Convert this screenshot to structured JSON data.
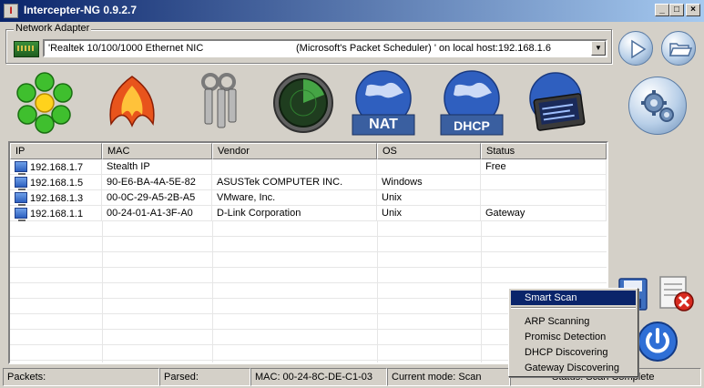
{
  "window": {
    "title": "Intercepter-NG 0.9.2.7",
    "minimize": "_",
    "maximize": "□",
    "close": "×"
  },
  "adapter": {
    "group_label": "Network Adapter",
    "name": "'Realtek 10/100/1000 Ethernet NIC",
    "host_text": "(Microsoft's Packet Scheduler) ' on local host:192.168.1.6"
  },
  "toolbar": {
    "nat_label": "NAT",
    "dhcp_label": "DHCP"
  },
  "table": {
    "columns": [
      "IP",
      "MAC",
      "Vendor",
      "OS",
      "Status"
    ],
    "rows": [
      {
        "ip": "192.168.1.7",
        "mac": "Stealth IP",
        "vendor": "",
        "os": "",
        "status": "Free"
      },
      {
        "ip": "192.168.1.5",
        "mac": "90-E6-BA-4A-5E-82",
        "vendor": "ASUSTek COMPUTER INC.",
        "os": "Windows",
        "status": ""
      },
      {
        "ip": "192.168.1.3",
        "mac": "00-0C-29-A5-2B-A5",
        "vendor": "VMware, Inc.",
        "os": "Unix",
        "status": ""
      },
      {
        "ip": "192.168.1.1",
        "mac": "00-24-01-A1-3F-A0",
        "vendor": "D-Link Corporation",
        "os": "Unix",
        "status": "Gateway"
      }
    ]
  },
  "context_menu": {
    "items": [
      "Smart Scan",
      "ARP Scanning",
      "Promisc Detection",
      "DHCP Discovering",
      "Gateway Discovering"
    ]
  },
  "status": {
    "packets": "Packets:",
    "parsed": "Parsed:",
    "mac": "MAC: 00-24-8C-DE-C1-03",
    "mode": "Current mode: Scan",
    "scan": "Status: Scan Complete"
  },
  "colors": {
    "title_bar": "#0a246a",
    "selection": "#0a246a"
  }
}
